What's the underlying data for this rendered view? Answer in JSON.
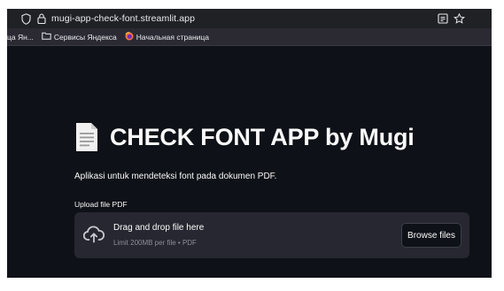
{
  "browser": {
    "url": "mugi-app-check-font.streamlit.app",
    "bookmarks": [
      {
        "label": "ца Ян...",
        "icon": "none"
      },
      {
        "label": "Сервисы Яндекса",
        "icon": "folder-icon"
      },
      {
        "label": "Начальная страница",
        "icon": "firefox-icon"
      }
    ]
  },
  "app": {
    "title_icon": "document-icon",
    "title": "CHECK FONT APP by Mugi",
    "description": "Aplikasi untuk mendeteksi font pada dokumen PDF.",
    "uploader": {
      "label": "Upload file PDF",
      "primary": "Drag and drop file here",
      "secondary": "Limit 200MB per file • PDF",
      "button": "Browse files",
      "icon": "cloud-upload-icon"
    }
  },
  "colors": {
    "app_bg": "#0e1117",
    "dropzone_bg": "#262730",
    "text": "#fafafa",
    "muted": "#8b8d98"
  }
}
